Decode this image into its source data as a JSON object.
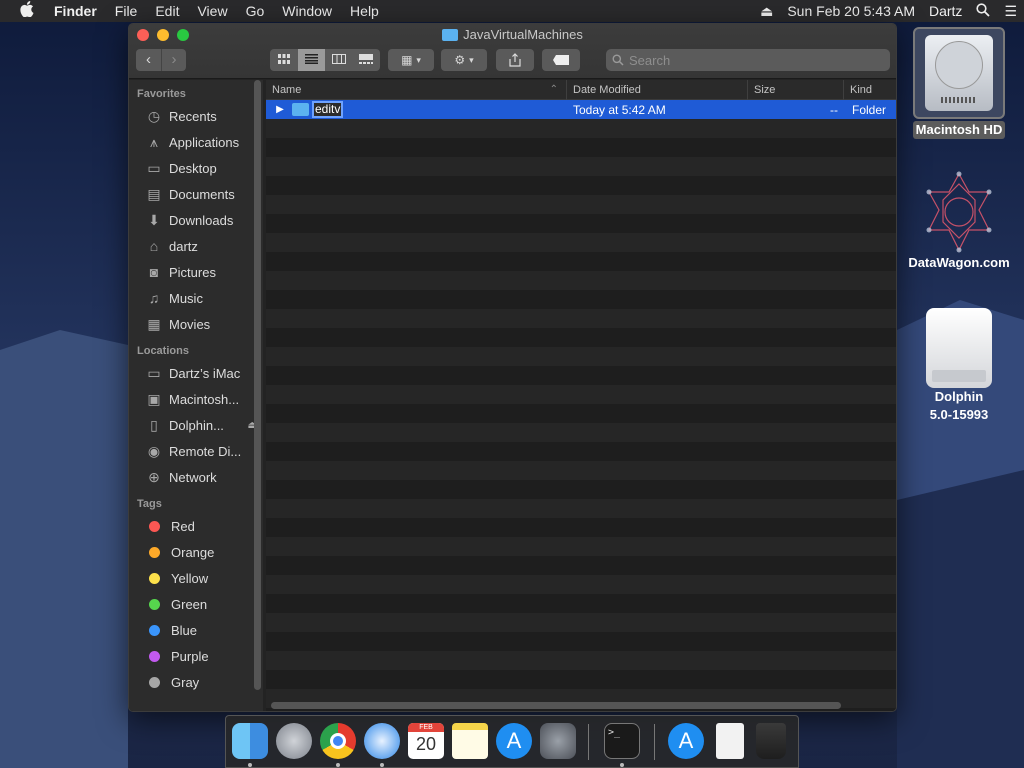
{
  "menubar": {
    "apple_icon": "apple-logo-icon",
    "app_name": "Finder",
    "menus": [
      "File",
      "Edit",
      "View",
      "Go",
      "Window",
      "Help"
    ],
    "datetime": "Sun Feb 20  5:43 AM",
    "user": "Dartz"
  },
  "window": {
    "title": "JavaVirtualMachines",
    "search_placeholder": "Search",
    "columns": {
      "name": "Name",
      "date": "Date Modified",
      "size": "Size",
      "kind": "Kind"
    },
    "rows": [
      {
        "name": "editv",
        "date": "Today at 5:42 AM",
        "size": "--",
        "kind": "Folder",
        "selected": true,
        "editing": true
      }
    ]
  },
  "sidebar": {
    "favorites_label": "Favorites",
    "favorites": [
      {
        "label": "Recents",
        "icon": "clock-icon"
      },
      {
        "label": "Applications",
        "icon": "applications-icon"
      },
      {
        "label": "Desktop",
        "icon": "desktop-icon"
      },
      {
        "label": "Documents",
        "icon": "document-icon"
      },
      {
        "label": "Downloads",
        "icon": "download-icon"
      },
      {
        "label": "dartz",
        "icon": "home-icon"
      },
      {
        "label": "Pictures",
        "icon": "camera-icon"
      },
      {
        "label": "Music",
        "icon": "music-icon"
      },
      {
        "label": "Movies",
        "icon": "film-icon"
      }
    ],
    "locations_label": "Locations",
    "locations": [
      {
        "label": "Dartz’s iMac",
        "icon": "imac-icon"
      },
      {
        "label": "Macintosh...",
        "icon": "disk-icon"
      },
      {
        "label": "Dolphin...",
        "icon": "drive-icon"
      },
      {
        "label": "Remote Di...",
        "icon": "optical-disc-icon"
      },
      {
        "label": "Network",
        "icon": "globe-icon"
      }
    ],
    "tags_label": "Tags",
    "tags": [
      {
        "label": "Red",
        "color": "#fc5753"
      },
      {
        "label": "Orange",
        "color": "#fda929"
      },
      {
        "label": "Yellow",
        "color": "#fde14b"
      },
      {
        "label": "Green",
        "color": "#56d64d"
      },
      {
        "label": "Blue",
        "color": "#3a95fc"
      },
      {
        "label": "Purple",
        "color": "#c25af0"
      },
      {
        "label": "Gray",
        "color": "#a7a7a7"
      }
    ]
  },
  "desktop": {
    "icons": [
      {
        "label": "Macintosh HD"
      },
      {
        "label": "DataWagon.com"
      },
      {
        "label_line1": "Dolphin",
        "label_line2": "5.0-15993"
      }
    ]
  },
  "dock": {
    "apps": [
      "Finder",
      "Launchpad",
      "Chrome",
      "Safari",
      "Calendar",
      "Notes",
      "App Store",
      "System Preferences",
      "Terminal",
      "App Store Download",
      "Disk Image",
      "Trash"
    ],
    "calendar_month": "FEB",
    "calendar_day": "20"
  },
  "colors": {
    "selection": "#1f5bd6",
    "folder": "#5bb2f0"
  }
}
